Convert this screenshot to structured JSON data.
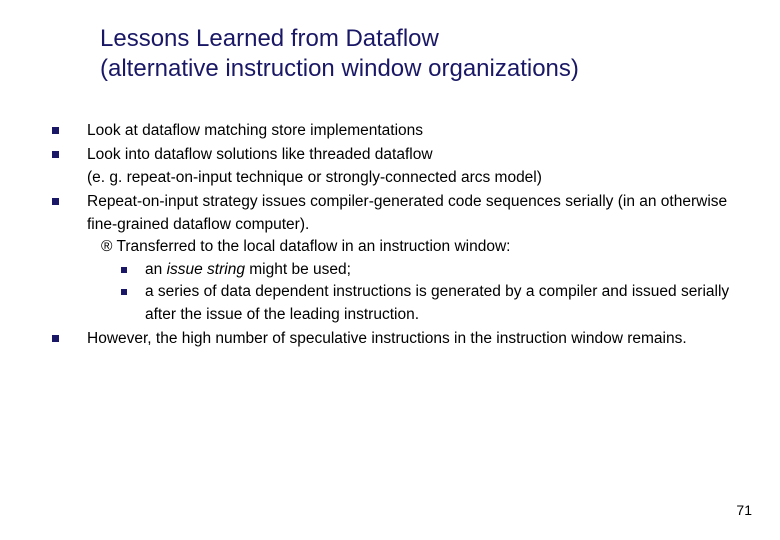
{
  "title_line1": "Lessons Learned from Dataflow",
  "title_line2": "(alternative instruction window organizations)",
  "items": {
    "b1": "Look at dataflow matching store implementations",
    "b2a": "Look into dataflow solutions like threaded dataflow",
    "b2b": "(e. g. repeat-on-input technique or strongly-connected arcs model)",
    "b3a": "Repeat-on-input strategy issues compiler-generated code sequences serially (in an otherwise fine-grained dataflow computer).",
    "b3_arrow_prefix": "®",
    "b3_arrow_text": " Transferred to the local dataflow in an instruction window:",
    "b3_s1_pre": "an ",
    "b3_s1_it": "issue string",
    "b3_s1_post": " might be used;",
    "b3_s2": "a series of data dependent instructions is generated by a compiler and issued serially after the issue of the leading instruction.",
    "b4": "However, the high number of speculative instructions in the instruction window remains."
  },
  "page_number": "71"
}
